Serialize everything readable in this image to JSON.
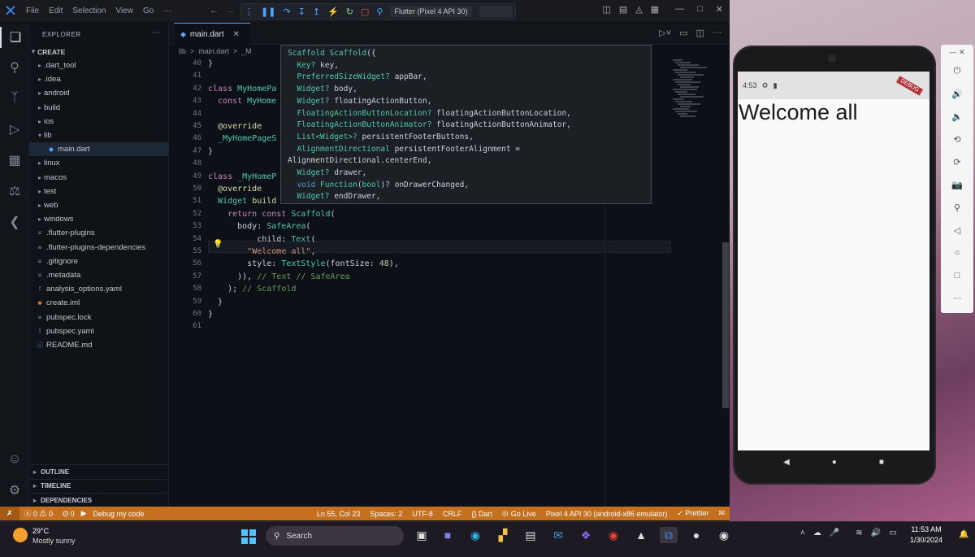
{
  "vscode": {
    "menus": [
      "File",
      "Edit",
      "Selection",
      "View",
      "Go",
      "···"
    ],
    "device_selector": "Flutter (Pixel 4 API 30)",
    "explorer_title": "EXPLORER",
    "project": "CREATE",
    "tree": [
      {
        "label": ".dart_tool",
        "kind": "folder"
      },
      {
        "label": ".idea",
        "kind": "folder"
      },
      {
        "label": "android",
        "kind": "folder"
      },
      {
        "label": "build",
        "kind": "folder"
      },
      {
        "label": "ios",
        "kind": "folder"
      },
      {
        "label": "lib",
        "kind": "folder-open"
      },
      {
        "label": "main.dart",
        "kind": "dart",
        "selected": true
      },
      {
        "label": "linux",
        "kind": "folder"
      },
      {
        "label": "macos",
        "kind": "folder"
      },
      {
        "label": "test",
        "kind": "folder"
      },
      {
        "label": "web",
        "kind": "folder"
      },
      {
        "label": "windows",
        "kind": "folder"
      },
      {
        "label": ".flutter-plugins",
        "kind": "file"
      },
      {
        "label": ".flutter-plugins-dependencies",
        "kind": "file"
      },
      {
        "label": ".gitignore",
        "kind": "file"
      },
      {
        "label": ".metadata",
        "kind": "file"
      },
      {
        "label": "analysis_options.yaml",
        "kind": "yaml"
      },
      {
        "label": "create.iml",
        "kind": "iml"
      },
      {
        "label": "pubspec.lock",
        "kind": "file"
      },
      {
        "label": "pubspec.yaml",
        "kind": "yaml"
      },
      {
        "label": "README.md",
        "kind": "md"
      }
    ],
    "sections": [
      "OUTLINE",
      "TIMELINE",
      "DEPENDENCIES"
    ],
    "tab": "main.dart",
    "breadcrumb": [
      "lib",
      ">",
      "main.dart",
      ">",
      "_M"
    ],
    "line_numbers": [
      "40",
      "41",
      "42",
      "43",
      "44",
      "45",
      "46",
      "47",
      "48",
      "49",
      "50",
      "51",
      "52",
      "53",
      "54",
      "55",
      "56",
      "57",
      "58",
      "59",
      "60",
      "61"
    ],
    "code_lines": [
      [
        [
          "}",
          "pl"
        ]
      ],
      [
        [
          "",
          "pl"
        ]
      ],
      [
        [
          "class ",
          "kw"
        ],
        [
          "MyHomePa",
          "ty"
        ]
      ],
      [
        [
          "  const ",
          "kw"
        ],
        [
          "MyHome",
          "ty"
        ]
      ],
      [
        [
          "",
          "pl"
        ]
      ],
      [
        [
          "  @override",
          "an"
        ]
      ],
      [
        [
          "  _MyHomePageS",
          "ty"
        ]
      ],
      [
        [
          "}",
          "pl"
        ]
      ],
      [
        [
          "",
          "pl"
        ]
      ],
      [
        [
          "class ",
          "kw"
        ],
        [
          "_MyHomeP",
          "ty"
        ]
      ],
      [
        [
          "  @override",
          "an"
        ]
      ],
      [
        [
          "  Widget ",
          "ty"
        ],
        [
          "build",
          "fn"
        ]
      ],
      [
        [
          "    return const ",
          "kw"
        ],
        [
          "Scaffold",
          "ty"
        ],
        [
          "(",
          "pl"
        ]
      ],
      [
        [
          "      body: ",
          "pl"
        ],
        [
          "SafeArea",
          "ty"
        ],
        [
          "(",
          "pl"
        ]
      ],
      [
        [
          "          child: ",
          "pl"
        ],
        [
          "Text",
          "ty"
        ],
        [
          "(",
          "pl"
        ]
      ],
      [
        [
          "        ",
          "pl"
        ],
        [
          "\"Welcome all\"",
          "st"
        ],
        [
          ",",
          "pl"
        ]
      ],
      [
        [
          "        style: ",
          "pl"
        ],
        [
          "TextStyle",
          "ty"
        ],
        [
          "(fontSize: ",
          "pl"
        ],
        [
          "48",
          "nu"
        ],
        [
          "),",
          "pl"
        ]
      ],
      [
        [
          "      )), ",
          "pl"
        ],
        [
          "// Text // SafeArea",
          "cm"
        ]
      ],
      [
        [
          "    ); ",
          "pl"
        ],
        [
          "// Scaffold",
          "cm"
        ]
      ],
      [
        [
          "  }",
          "pl"
        ]
      ],
      [
        [
          "}",
          "pl"
        ]
      ],
      [
        [
          "",
          "pl"
        ]
      ]
    ],
    "hover_lines": [
      [
        [
          "Scaffold ",
          "ty"
        ],
        [
          "Scaffold",
          "ty"
        ],
        [
          "({",
          "pl"
        ]
      ],
      [
        [
          "  Key? ",
          "ty"
        ],
        [
          "key,",
          "pl"
        ]
      ],
      [
        [
          "  PreferredSizeWidget? ",
          "ty"
        ],
        [
          "appBar,",
          "pl"
        ]
      ],
      [
        [
          "  Widget? ",
          "ty"
        ],
        [
          "body,",
          "pl"
        ]
      ],
      [
        [
          "  Widget? ",
          "ty"
        ],
        [
          "floatingActionButton,",
          "pl"
        ]
      ],
      [
        [
          "  FloatingActionButtonLocation? ",
          "ty"
        ],
        [
          "floatingActionButtonLocation,",
          "pl"
        ]
      ],
      [
        [
          "  FloatingActionButtonAnimator? ",
          "ty"
        ],
        [
          "floatingActionButtonAnimator,",
          "pl"
        ]
      ],
      [
        [
          "  List<Widget>? ",
          "ty"
        ],
        [
          "persistentFooterButtons,",
          "pl"
        ]
      ],
      [
        [
          "  AlignmentDirectional ",
          "ty"
        ],
        [
          "persistentFooterAlignment = ",
          "pl"
        ]
      ],
      [
        [
          "AlignmentDirectional.centerEnd,",
          "pl"
        ]
      ],
      [
        [
          "  Widget? ",
          "ty"
        ],
        [
          "drawer,",
          "pl"
        ]
      ],
      [
        [
          "  void ",
          "bl"
        ],
        [
          "Function",
          "ty"
        ],
        [
          "(",
          "pl"
        ],
        [
          "bool",
          "ty"
        ],
        [
          ")? onDrawerChanged,",
          "pl"
        ]
      ],
      [
        [
          "  Widget? ",
          "ty"
        ],
        [
          "endDrawer,",
          "pl"
        ]
      ]
    ],
    "status": {
      "problems": "ⓧ 0 ⚠ 0",
      "ports": "ʘ 0",
      "debug": "Debug my code",
      "position": "Ln 55, Col 23",
      "spaces": "Spaces: 2",
      "encoding": "UTF-8",
      "eol": "CRLF",
      "language": "{} Dart",
      "golive": "Go Live",
      "device": "Pixel 4 API 30 (android-x86 emulator)",
      "prettier": "✓ Prettier"
    }
  },
  "emulator": {
    "status_time": "4:53",
    "app_text": "Welcome all",
    "debug_banner": "DEBUG"
  },
  "taskbar": {
    "temperature": "29°C",
    "condition": "Mostly sunny",
    "search_placeholder": "Search",
    "time": "11:53 AM",
    "date": "1/30/2024"
  },
  "colors": {
    "statusbar": "#c5701f",
    "editor_bg": "#0d1117",
    "accent": "#4fa3ff"
  }
}
